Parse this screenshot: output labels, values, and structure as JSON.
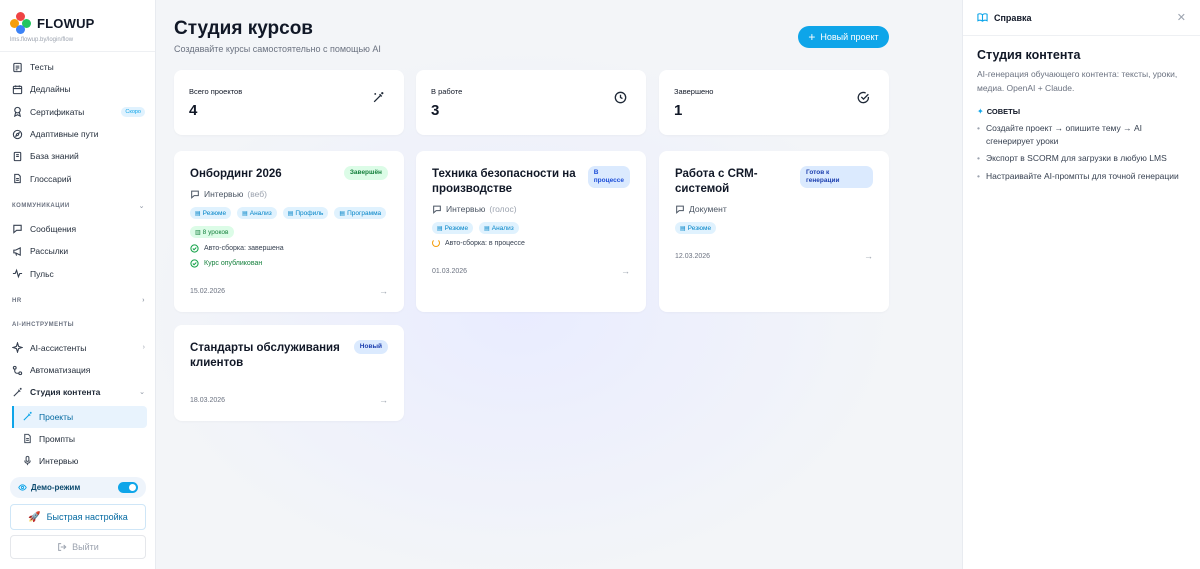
{
  "sidebar": {
    "brand": "FLOWUP",
    "url": "lms.flowup.by/login/flow",
    "items": [
      {
        "label": "Тесты"
      },
      {
        "label": "Дедлайны"
      },
      {
        "label": "Сертификаты",
        "badge": "Скоро"
      },
      {
        "label": "Адаптивные пути"
      },
      {
        "label": "База знаний"
      },
      {
        "label": "Глоссарий"
      }
    ],
    "section_comm": "КОММУНИКАЦИИ",
    "comm_items": [
      {
        "label": "Сообщения"
      },
      {
        "label": "Рассылки"
      },
      {
        "label": "Пульс"
      }
    ],
    "section_hr": "HR",
    "section_ai": "AI-ИНСТРУМЕНТЫ",
    "ai_items": [
      {
        "label": "AI-ассистенты"
      },
      {
        "label": "Автоматизация"
      },
      {
        "label": "Студия контента"
      }
    ],
    "sub_items": [
      {
        "label": "Проекты"
      },
      {
        "label": "Промпты"
      },
      {
        "label": "Интервью"
      }
    ],
    "demo_label": "Демо-режим",
    "quick_label": "Быстрая настройка",
    "logout_label": "Выйти"
  },
  "main": {
    "title": "Студия курсов",
    "subtitle": "Создавайте курсы самостоятельно с помощью AI",
    "new_button": "Новый проект",
    "stats": [
      {
        "label": "Всего проектов",
        "value": "4"
      },
      {
        "label": "В работе",
        "value": "3"
      },
      {
        "label": "Завершено",
        "value": "1"
      }
    ],
    "cards": [
      {
        "title": "Онбординг 2026",
        "status": "Завершён",
        "type": "Интервью",
        "type_sub": "(веб)",
        "tags": [
          "Резюме",
          "Анализ",
          "Профиль",
          "Программа",
          "8 уроков"
        ],
        "line1": "Авто-сборка: завершена",
        "line2": "Курс опубликован",
        "date": "15.02.2026"
      },
      {
        "title_1": "Техника безопасности на",
        "title_2": "производстве",
        "status_1": "В",
        "status_2": "процессе",
        "type": "Интервью",
        "type_sub": "(голос)",
        "tags": [
          "Резюме",
          "Анализ"
        ],
        "line1": "Авто-сборка: в процессе",
        "date": "01.03.2026"
      },
      {
        "title_1": "Работа с CRM-",
        "title_2": "системой",
        "status_1": "Готов к",
        "status_2": "генерации",
        "type": "Документ",
        "tags": [
          "Резюме"
        ],
        "date": "12.03.2026"
      },
      {
        "title_1": "Стандарты обслуживания",
        "title_2": "клиентов",
        "status": "Новый",
        "date": "18.03.2026"
      }
    ]
  },
  "help": {
    "header": "Справка",
    "title": "Студия контента",
    "desc": "AI-генерация обучающего контента: тексты, уроки, медиа. OpenAI + Claude.",
    "tips_title": "СОВЕТЫ",
    "tips": [
      "Создайте проект → опишите тему → AI сгенерирует уроки",
      "Экспорт в SCORM для загрузки в любую LMS",
      "Настраивайте AI-промпты для точной генерации"
    ]
  },
  "colors": {
    "accent": "#0ea5e9",
    "success": "#16a34a",
    "warning": "#f59e0b"
  }
}
